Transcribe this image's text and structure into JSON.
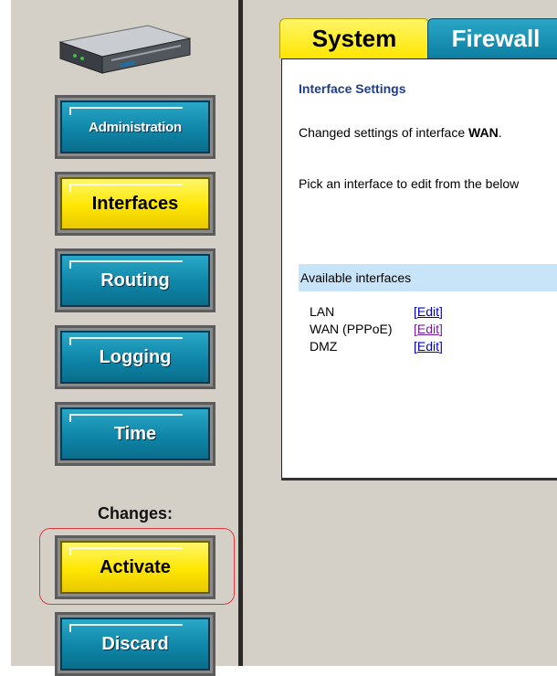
{
  "sidebar": {
    "device_alt": "D-Link firewall device",
    "nav": [
      {
        "label": "Administration",
        "state": "normal"
      },
      {
        "label": "Interfaces",
        "state": "active"
      },
      {
        "label": "Routing",
        "state": "normal"
      },
      {
        "label": "Logging",
        "state": "normal"
      },
      {
        "label": "Time",
        "state": "normal"
      }
    ],
    "changes_label": "Changes:",
    "activate_label": "Activate",
    "discard_label": "Discard"
  },
  "tabs": [
    {
      "label": "System",
      "active": true
    },
    {
      "label": "Firewall",
      "active": false
    }
  ],
  "content": {
    "section_title": "Interface Settings",
    "message_prefix": "Changed settings of interface ",
    "message_interface": "WAN",
    "message_suffix": ".",
    "pick_text": "Pick an interface to edit from the below",
    "available_header": "Available interfaces",
    "interfaces": [
      {
        "name": "LAN",
        "edit": "Edit"
      },
      {
        "name": "WAN (PPPoE)",
        "edit": "Edit"
      },
      {
        "name": "DMZ",
        "edit": "Edit"
      }
    ]
  },
  "colors": {
    "accent_blue": "#0f86a8",
    "accent_yellow": "#ffe600",
    "highlight_red": "#e0393e",
    "section_title": "#1e3c8c",
    "list_header_bg": "#c8e4f8"
  }
}
